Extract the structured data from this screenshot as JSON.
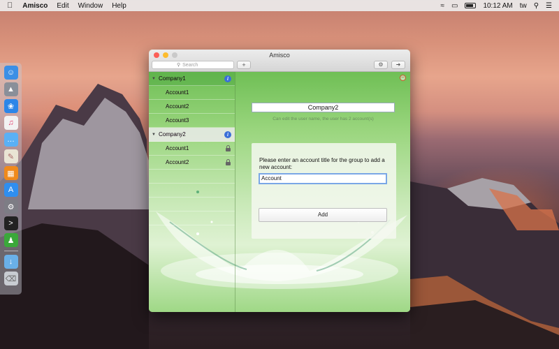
{
  "menubar": {
    "app_name": "Amisco",
    "items": [
      "Edit",
      "Window",
      "Help"
    ],
    "time": "10:12 AM",
    "user": "tw"
  },
  "window": {
    "title": "Amisco",
    "search_placeholder": "Search",
    "add_label": "+"
  },
  "sidebar": {
    "groups": [
      {
        "name": "Company1",
        "accounts": [
          "Account1",
          "Account2",
          "Account3"
        ]
      },
      {
        "name": "Company2",
        "accounts": [
          "Account1",
          "Account2"
        ]
      }
    ]
  },
  "detail": {
    "group_name": "Company2",
    "hint": "Can edit the user name, the user has 2 account(s)",
    "prompt": "Please enter an account title for the group to add a new account:",
    "account_value": "Account",
    "add_button": "Add"
  },
  "colors": {
    "accent": "#3a6fd8",
    "window_green": "#8fcf72"
  }
}
